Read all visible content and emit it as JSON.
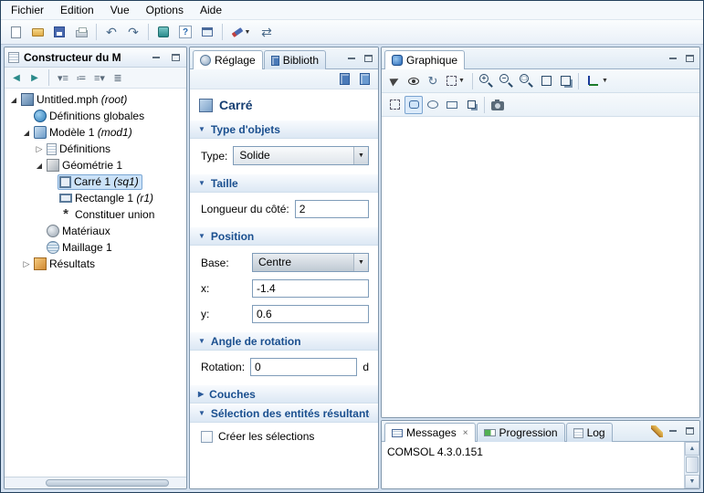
{
  "menubar": {
    "items": [
      "Fichier",
      "Edition",
      "Vue",
      "Options",
      "Aide"
    ]
  },
  "model_builder": {
    "title": "Constructeur du M",
    "tree": [
      {
        "label": "Untitled.mph",
        "suffix": "(root)"
      },
      {
        "label": "Définitions globales",
        "suffix": ""
      },
      {
        "label": "Modèle 1",
        "suffix": "(mod1)"
      },
      {
        "label": "Définitions",
        "suffix": ""
      },
      {
        "label": "Géométrie 1",
        "suffix": ""
      },
      {
        "label": "Carré 1",
        "suffix": "(sq1)"
      },
      {
        "label": "Rectangle 1",
        "suffix": "(r1)"
      },
      {
        "label": "Constituer union",
        "suffix": ""
      },
      {
        "label": "Matériaux",
        "suffix": ""
      },
      {
        "label": "Maillage 1",
        "suffix": ""
      },
      {
        "label": "Résultats",
        "suffix": ""
      }
    ]
  },
  "settings_panel": {
    "tab_reglage": "Réglage",
    "tab_biblio": "Biblioth",
    "title": "Carré",
    "section_type": {
      "header": "Type d'objets",
      "type_label": "Type:",
      "type_value": "Solide"
    },
    "section_taille": {
      "header": "Taille",
      "length_label": "Longueur du côté:",
      "length_value": "2"
    },
    "section_position": {
      "header": "Position",
      "base_label": "Base:",
      "base_value": "Centre",
      "x_label": "x:",
      "x_value": "-1.4",
      "y_label": "y:",
      "y_value": "0.6"
    },
    "section_rotation": {
      "header": "Angle de rotation",
      "rotation_label": "Rotation:",
      "rotation_value": "0",
      "unit": "d"
    },
    "section_couches": {
      "header": "Couches"
    },
    "section_selection": {
      "header": "Sélection des entités résultante",
      "checkbox_label": "Créer les sélections"
    }
  },
  "graphics_panel": {
    "tab": "Graphique"
  },
  "messages_panel": {
    "tab_messages": "Messages",
    "tab_progression": "Progression",
    "tab_log": "Log",
    "content": "COMSOL 4.3.0.151"
  },
  "colors": {
    "accent": "#1a4f8f",
    "selection": "#cbe2f8",
    "panel_border": "#8096ab"
  }
}
